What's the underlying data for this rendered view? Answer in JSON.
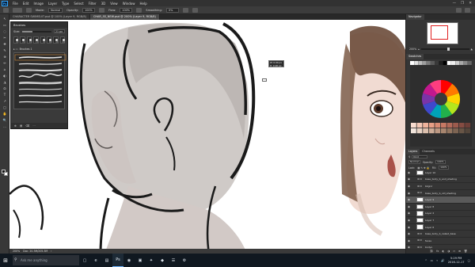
{
  "app": {
    "logo": "Ps",
    "menu": [
      "File",
      "Edit",
      "Image",
      "Layer",
      "Type",
      "Select",
      "Filter",
      "3D",
      "View",
      "Window",
      "Help"
    ],
    "window_controls": [
      "—",
      "❐",
      "✕"
    ]
  },
  "options_bar": {
    "mode_label": "Mode:",
    "mode_value": "Normal",
    "opacity_label": "Opacity:",
    "opacity_value": "100%",
    "flow_label": "Flow:",
    "flow_value": "100%",
    "smoothing_label": "Smoothing:",
    "smoothing_value": "0%"
  },
  "doc_tabs": [
    {
      "label": "CHARACTER SWIMSUIT.psd @ 100% (Layer 9, RGB/8)",
      "active": false
    },
    {
      "label": "CHAR_SS_NEW.psd @ 200% (Layer 9, RGB/8)",
      "active": true
    }
  ],
  "tools": [
    "↖",
    "▭",
    "◌",
    "✂",
    "✥",
    "✎",
    "⊕",
    "✏",
    "⌂",
    "◐",
    "◮",
    "⬭",
    "T",
    "↗",
    "▢",
    "✋",
    "🔍",
    "…"
  ],
  "brushes_panel": {
    "title": "Brushes",
    "size_label": "Size:",
    "size_value": "21 px",
    "size_fraction": 0.35,
    "presets": [
      "17",
      "21",
      "30",
      "13",
      "9",
      "38",
      "45",
      "60"
    ],
    "group_label": "Brushes 1",
    "footer_icons": [
      "⊕",
      "▤",
      "⌫",
      "⋯"
    ]
  },
  "readout": {
    "line1": "W: 0.00 px",
    "line2": "H: 0.00 px"
  },
  "navigator": {
    "tabs": [
      "Navigator"
    ],
    "zoom_value": "200%"
  },
  "swatches": {
    "tabs": [
      "Swatches"
    ],
    "top_row": [
      "#ffffff",
      "#e0e0e0",
      "#bdbdbd",
      "#9e9e9e",
      "#7a7a7a",
      "#5a5a5a",
      "#3a3a3a",
      "#1e1e1e",
      "#000000",
      "#ffffff",
      "#eeeeee",
      "#cccccc",
      "#aaaaaa",
      "#888888",
      "#666666"
    ],
    "wheel_colors": [
      "#ff0000",
      "#ff7a00",
      "#ffd400",
      "#b5e61d",
      "#22b14c",
      "#00a2b8",
      "#3f48cc",
      "#7a34a8",
      "#c2188e",
      "#ff3d7f"
    ],
    "grid_colors": [
      "#f8dccf",
      "#f4c8b6",
      "#efb39c",
      "#e79f86",
      "#d98c74",
      "#c77964",
      "#b36a59",
      "#9c5b4d",
      "#854c42",
      "#6e3f38",
      "#f1e5dc",
      "#e8d3c4",
      "#dcc0ad",
      "#cdac97",
      "#bc9882",
      "#a8866f",
      "#93755f",
      "#7d6452",
      "#685546",
      "#54463b"
    ]
  },
  "layers": {
    "tabs": [
      "Layers",
      "Channels"
    ],
    "filter_label": "Kind",
    "mode_value": "Normal",
    "opacity_label": "Opacity:",
    "opacity_value": "100%",
    "lock_label": "Lock:",
    "fill_label": "Fill:",
    "fill_value": "100%",
    "rows": [
      {
        "name": "Layer 10",
        "kind": "layer",
        "selected": false
      },
      {
        "name": "base_body_b_and_shading",
        "kind": "folder",
        "selected": false
      },
      {
        "name": "bkgnd",
        "kind": "folder",
        "selected": false
      },
      {
        "name": "base_body_b_old_shading",
        "kind": "folder",
        "selected": false
      },
      {
        "name": "Layer 9",
        "kind": "layer",
        "selected": true
      },
      {
        "name": "Layer 8",
        "kind": "layer",
        "selected": false
      },
      {
        "name": "Layer 2",
        "kind": "layer",
        "selected": false
      },
      {
        "name": "Layer 7",
        "kind": "layer",
        "selected": false
      },
      {
        "name": "Layer 6",
        "kind": "layer",
        "selected": false
      },
      {
        "name": "base_body_b_naked_base",
        "kind": "folder",
        "selected": false
      },
      {
        "name": "faces",
        "kind": "folder",
        "selected": false
      },
      {
        "name": "bodys",
        "kind": "folder",
        "selected": false
      },
      {
        "name": "base_body_b_base",
        "kind": "dark",
        "selected": false
      }
    ],
    "footer_icons": [
      "⛓",
      "fx",
      "◐",
      "◑",
      "▭",
      "⊞",
      "🗑"
    ]
  },
  "status": {
    "zoom": "200%",
    "doc_info": "Doc: 20.3M/205.3M",
    "arrow": "›"
  },
  "taskbar": {
    "start_icon": "⊞",
    "search_icon": "⚲",
    "search_placeholder": "Ask me anything",
    "apps": [
      {
        "label": "▢",
        "active": false
      },
      {
        "label": "e",
        "active": false
      },
      {
        "label": "▤",
        "active": false
      },
      {
        "label": "Ps",
        "active": true
      },
      {
        "label": "◉",
        "active": false
      },
      {
        "label": "▣",
        "active": false
      },
      {
        "label": "✦",
        "active": false
      },
      {
        "label": "◆",
        "active": false
      },
      {
        "label": "☰",
        "active": false
      },
      {
        "label": "⚙",
        "active": false
      }
    ],
    "tray_icons": [
      "^",
      "▭",
      "⌁",
      "🔊"
    ],
    "time": "5:29 PM",
    "date": "2016-12-17",
    "notification_icon": "▢"
  }
}
